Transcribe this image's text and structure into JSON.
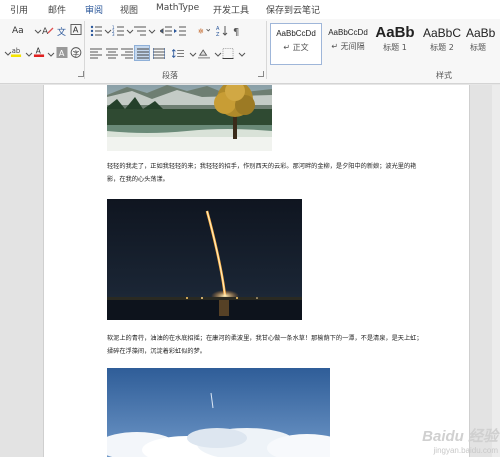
{
  "tabs": [
    {
      "label": "引用"
    },
    {
      "label": "邮件"
    },
    {
      "label": "审阅"
    },
    {
      "label": "视图"
    },
    {
      "label": "MathType"
    },
    {
      "label": "开发工具"
    },
    {
      "label": "保存到云笔记"
    }
  ],
  "ribbon": {
    "font_size_button": "Aa",
    "paragraph_group_label": "段落",
    "styles_group_label": "样式",
    "styles": [
      {
        "preview": "AaBbCcDd",
        "name": "↵ 正文"
      },
      {
        "preview": "AaBbCcDd",
        "name": "↵ 无间隔"
      },
      {
        "preview": "AaBb",
        "name": "标题 1"
      },
      {
        "preview": "AaBbC",
        "name": "标题 2"
      },
      {
        "preview": "AaBb",
        "name": "标题"
      }
    ],
    "colors": {
      "highlight": "#f5e400",
      "font_color": "#e02020",
      "accent": "#2b579a"
    }
  },
  "document": {
    "paragraph_1": "轻轻的我走了，正如我轻轻的来；我轻轻的招手，作别西天的云彩。那河畔的金柳，是夕阳中的新娘；波光里的艳影，在我的心头荡漾。",
    "paragraph_2": "软泥上的青荇，油油的在水底招摇；在康河的柔波里，我甘心做一条水草！那榆荫下的一潭，不是清泉，是天上虹；揉碎在浮藻间，沉淀着彩虹似的梦。"
  },
  "watermark": {
    "text": "Baidu 经验",
    "url": "jingyan.baidu.com"
  }
}
